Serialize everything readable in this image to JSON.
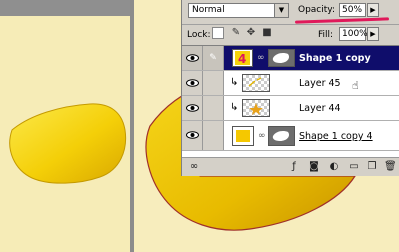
{
  "layers_panel": {
    "blend_mode": "Normal",
    "opacity_label": "Opacity:",
    "opacity_value": "50%",
    "lock_label": "Lock:",
    "fill_label": "Fill:",
    "fill_value": "100%",
    "layers": [
      {
        "name": "Shape 1 copy",
        "selected": true,
        "thumb_label": "4"
      },
      {
        "name": "Layer 45",
        "selected": false,
        "clipped": true
      },
      {
        "name": "Layer 44",
        "selected": false,
        "clipped": true
      },
      {
        "name": "Shape 1 copy 4",
        "selected": false
      }
    ]
  },
  "colors": {
    "canvas_bg": "#f6ecb7",
    "shape_yellow": "#f6d20a",
    "selection_blue": "#0f0d6b",
    "annotation_red": "#e0195a"
  }
}
